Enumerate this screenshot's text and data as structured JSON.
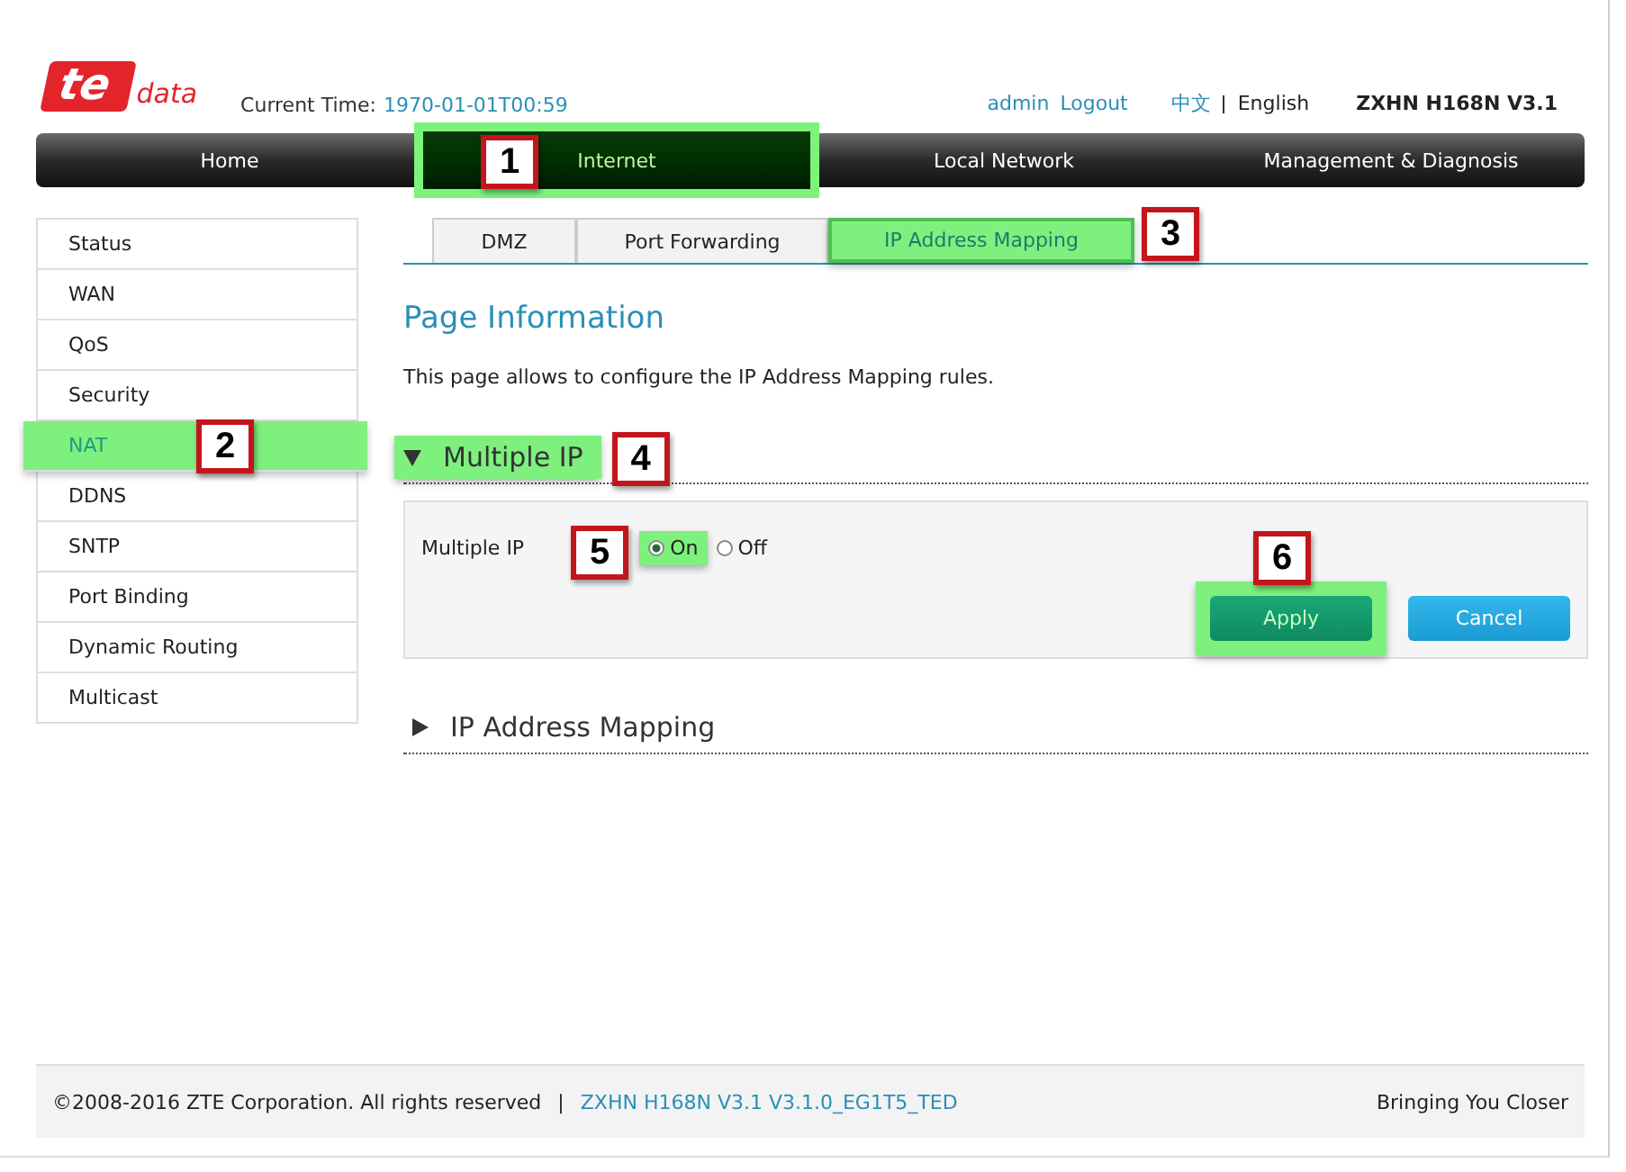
{
  "header": {
    "logo": {
      "mark": "te",
      "word": "data"
    },
    "time_label": "Current Time:",
    "time_value": "1970-01-01T00:59",
    "user": "admin",
    "logout": "Logout",
    "languages": [
      {
        "label": "中文",
        "selected": false
      },
      {
        "label": "English",
        "selected": true
      }
    ],
    "model": "ZXHN H168N V3.1"
  },
  "nav": [
    {
      "label": "Home",
      "selected": false,
      "highlighted": false
    },
    {
      "label": "Internet",
      "selected": true,
      "highlighted": true,
      "callout": "1"
    },
    {
      "label": "Local Network",
      "selected": false,
      "highlighted": false
    },
    {
      "label": "Management & Diagnosis",
      "selected": false,
      "highlighted": false
    }
  ],
  "sidebar": {
    "items": [
      {
        "label": "Status",
        "selected": false,
        "highlighted": false
      },
      {
        "label": "WAN",
        "selected": false,
        "highlighted": false
      },
      {
        "label": "QoS",
        "selected": false,
        "highlighted": false
      },
      {
        "label": "Security",
        "selected": false,
        "highlighted": false
      },
      {
        "label": "NAT",
        "selected": true,
        "highlighted": true,
        "callout": "2"
      },
      {
        "label": "DDNS",
        "selected": false,
        "highlighted": false
      },
      {
        "label": "SNTP",
        "selected": false,
        "highlighted": false
      },
      {
        "label": "Port Binding",
        "selected": false,
        "highlighted": false
      },
      {
        "label": "Dynamic Routing",
        "selected": false,
        "highlighted": false
      },
      {
        "label": "Multicast",
        "selected": false,
        "highlighted": false
      }
    ]
  },
  "tabs": [
    {
      "label": "DMZ",
      "selected": false,
      "highlighted": false
    },
    {
      "label": "Port Forwarding",
      "selected": false,
      "highlighted": false
    },
    {
      "label": "IP Address Mapping",
      "selected": true,
      "highlighted": true,
      "callout": "3"
    }
  ],
  "page_title": "Page Information",
  "description": "This page allows to configure the IP Address Mapping rules.",
  "sections": [
    {
      "title": "Multiple IP",
      "expanded": true,
      "highlighted": true,
      "callout": "4",
      "field_label": "Multiple IP",
      "options": [
        {
          "label": "On",
          "selected": true,
          "highlighted": true,
          "callout": "5"
        },
        {
          "label": "Off",
          "selected": false,
          "highlighted": false
        }
      ],
      "buttons": [
        {
          "label": "Apply",
          "kind": "apply",
          "highlighted": true,
          "callout": "6"
        },
        {
          "label": "Cancel",
          "kind": "cancel",
          "highlighted": false
        }
      ]
    },
    {
      "title": "IP Address Mapping",
      "expanded": false,
      "highlighted": false
    }
  ],
  "footer": {
    "copyright": "©2008-2016 ZTE Corporation. All rights reserved",
    "separator": "|",
    "version": "ZXHN H168N V3.1 V3.1.0_EG1T5_TED",
    "slogan": "Bringing You Closer"
  }
}
